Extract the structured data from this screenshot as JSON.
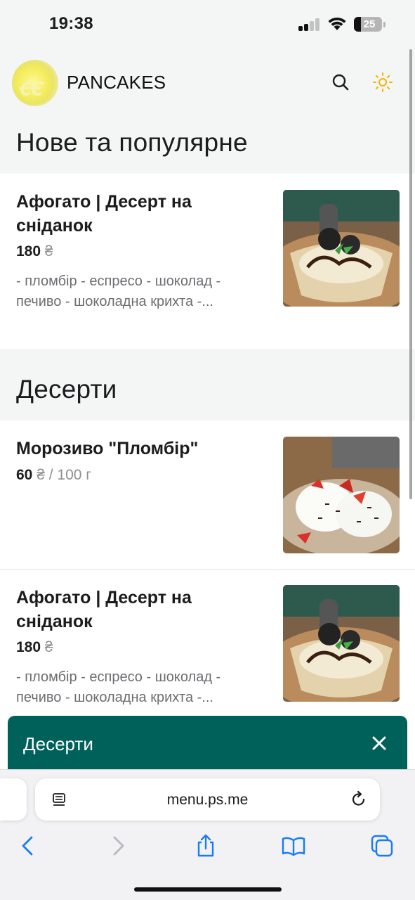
{
  "status_bar": {
    "time": "19:38",
    "battery": "25"
  },
  "header": {
    "brand": "PANCAKES",
    "icons": [
      "search-icon",
      "sun-icon"
    ]
  },
  "sections": [
    {
      "title": "Нове та популярне",
      "items": [
        {
          "title": "Афогато | Десерт на сніданок",
          "price": "180",
          "currency": "₴",
          "unit": "",
          "description": "- пломбір - еспресо - шоколад - печиво - шоколадна крихта -..."
        }
      ]
    },
    {
      "title": "Десерти",
      "items": [
        {
          "title": "Морозиво \"Пломбір\"",
          "price": "60",
          "currency": "₴",
          "unit": "/ 100 г",
          "description": ""
        },
        {
          "title": "Афогато | Десерт на сніданок",
          "price": "180",
          "currency": "₴",
          "unit": "",
          "description": "- пломбір - еспресо - шоколад - печиво - шоколадна крихта -..."
        }
      ]
    }
  ],
  "category_sheet": {
    "title": "Десерти"
  },
  "browser": {
    "url": "menu.ps.me",
    "toolbar_icons": [
      "back-icon",
      "forward-icon",
      "share-icon",
      "bookmarks-icon",
      "tabs-icon"
    ]
  },
  "colors": {
    "accent": "#00615a",
    "sun": "#f2b400",
    "safari_blue": "#1a7cf5"
  }
}
